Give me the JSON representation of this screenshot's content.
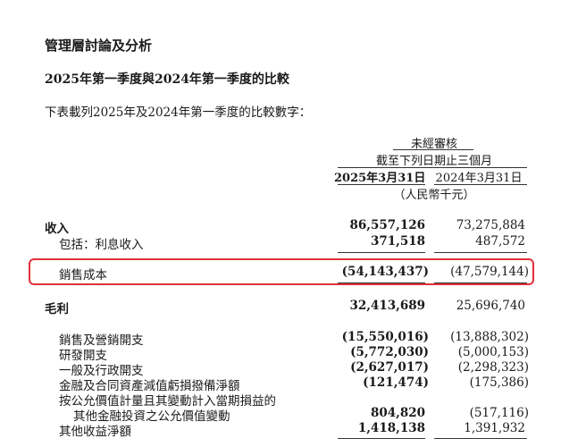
{
  "heading": "管理層討論及分析",
  "subheading": "2025年第一季度與2024年第一季度的比較",
  "intro": "下表載列2025年及2024年第一季度的比較數字：",
  "columns": {
    "audit_status": "未經審核",
    "period": "截至下列日期止三個月",
    "col_2025": "2025年3月31日",
    "col_2024": "2024年3月31日",
    "unit": "（人民幣千元）"
  },
  "rows": [
    {
      "label": "收入",
      "v2025": "86,557,126",
      "v2024": "73,275,884"
    },
    {
      "label": "包括：利息收入",
      "v2025": "371,518",
      "v2024": "487,572"
    },
    {
      "label": "銷售成本",
      "v2025": "(54,143,437)",
      "v2024": "(47,579,144)"
    },
    {
      "label": "毛利",
      "v2025": "32,413,689",
      "v2024": "25,696,740"
    },
    {
      "label": "銷售及營銷開支",
      "v2025": "(15,550,016)",
      "v2024": "(13,888,302)"
    },
    {
      "label": "研發開支",
      "v2025": "(5,772,030)",
      "v2024": "(5,000,153)"
    },
    {
      "label": "一般及行政開支",
      "v2025": "(2,627,017)",
      "v2024": "(2,298,323)"
    },
    {
      "label": "金融及合同資產減值虧損撥備淨額",
      "v2025": "(121,474)",
      "v2024": "(175,386)"
    },
    {
      "label": "按公允價值計量且其變動計入當期損益的",
      "v2025": "",
      "v2024": ""
    },
    {
      "label": "其他金融投資之公允價值變動",
      "v2025": "804,820",
      "v2024": "(517,116)"
    },
    {
      "label": "其他收益淨額",
      "v2025": "1,418,138",
      "v2024": "1,391,932"
    }
  ],
  "highlight_color": "#e0313a"
}
